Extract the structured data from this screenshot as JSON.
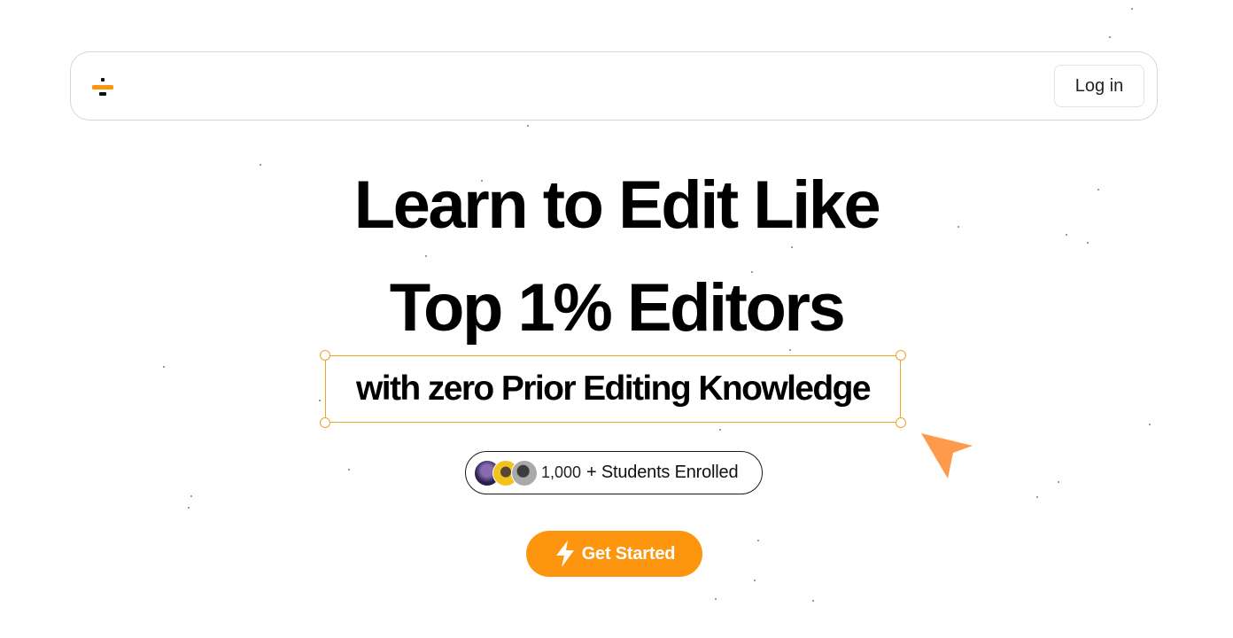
{
  "navbar": {
    "logo_icon": "logo-icon",
    "login_label": "Log in"
  },
  "hero": {
    "line1": "Learn to Edit Like",
    "line2": "Top 1% Editors",
    "subheading": "with zero Prior Editing Knowledge"
  },
  "enrolled": {
    "count": "1,000",
    "label": "+ Students Enrolled"
  },
  "cta": {
    "label": "Get Started",
    "icon": "lightning-icon"
  },
  "colors": {
    "accent": "#fe950e",
    "selection_border": "#f0a32a",
    "cursor": "#fe9a4a"
  }
}
